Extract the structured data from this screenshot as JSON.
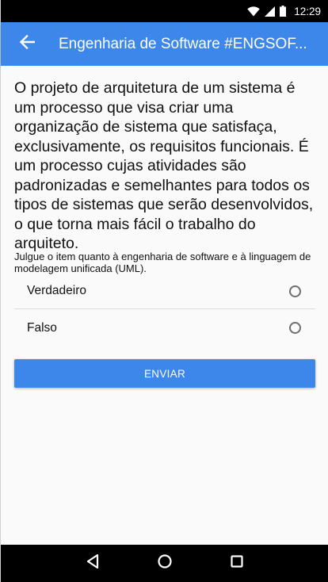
{
  "status_bar": {
    "time": "12:29",
    "icons": [
      "wifi-icon",
      "cell-signal-icon",
      "battery-icon"
    ]
  },
  "app_bar": {
    "back_icon": "arrow-left-icon",
    "title": "Engenharia de Software #ENGSOF..."
  },
  "question": {
    "text": "O projeto de arquitetura de um sistema é um processo que visa criar uma organização de sistema que satisfaça, exclusivamente, os requisitos funcionais. É um processo cujas atividades são padronizadas e semelhantes para todos os tipos de sistemas que serão desenvolvidos, o que torna mais fácil o trabalho do arquiteto.",
    "instruction": "Julgue o item quanto à engenharia de software e à linguagem de modelagem unificada (UML)."
  },
  "options": [
    {
      "label": "Verdadeiro",
      "selected": false
    },
    {
      "label": "Falso",
      "selected": false
    }
  ],
  "submit": {
    "label": "ENVIAR"
  },
  "nav_bar": {
    "icons": [
      "back-triangle-icon",
      "home-circle-icon",
      "recents-square-icon"
    ]
  },
  "colors": {
    "primary": "#3d87ea",
    "background": "#fafafa",
    "text": "#111111"
  }
}
